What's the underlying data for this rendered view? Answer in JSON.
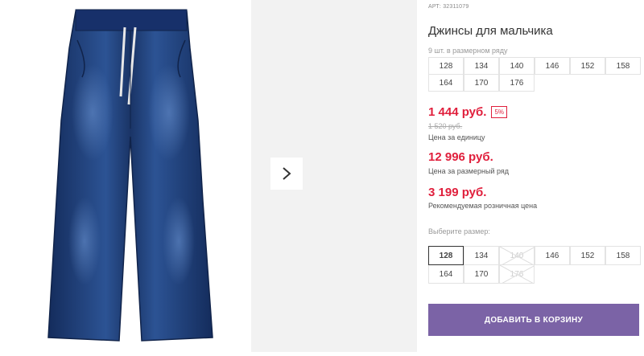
{
  "product": {
    "sku_label": "АРТ:",
    "sku_value": "32311079",
    "title": "Джинсы для мальчика",
    "pack_note": "9 шт. в размерном ряду",
    "pack_sizes": [
      "128",
      "134",
      "140",
      "146",
      "152",
      "158",
      "164",
      "170",
      "176"
    ],
    "price": "1 444 руб.",
    "discount": "5%",
    "old_price": "1 520 руб.",
    "unit_price_label": "Цена за единицу",
    "pack_price": "12 996 руб.",
    "pack_price_label": "Цена за размерный ряд",
    "retail_price": "3 199 руб.",
    "retail_price_label": "Рекомендуемая розничная цена",
    "choose_size_label": "Выберите размер:",
    "sizes": [
      {
        "label": "128",
        "state": "selected"
      },
      {
        "label": "134",
        "state": "available"
      },
      {
        "label": "140",
        "state": "disabled"
      },
      {
        "label": "146",
        "state": "available"
      },
      {
        "label": "152",
        "state": "available"
      },
      {
        "label": "158",
        "state": "available"
      },
      {
        "label": "164",
        "state": "available"
      },
      {
        "label": "170",
        "state": "available"
      },
      {
        "label": "176",
        "state": "disabled"
      }
    ],
    "add_to_cart": "ДОБАВИТЬ В КОРЗИНУ"
  },
  "gallery": {
    "next_icon": "chevron-right-icon",
    "jeans_color": "#1d3a73"
  }
}
